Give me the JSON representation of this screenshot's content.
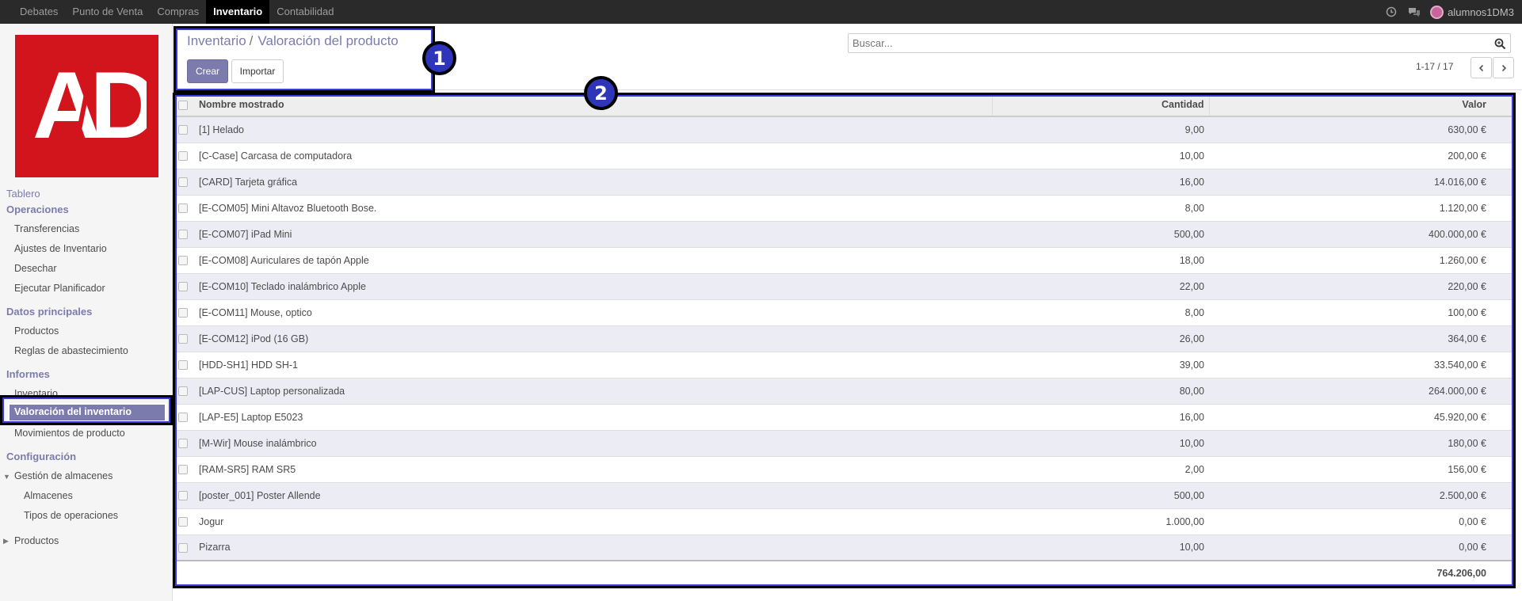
{
  "topbar": {
    "menu": [
      "Debates",
      "Punto de Venta",
      "Compras",
      "Inventario",
      "Contabilidad"
    ],
    "active_menu": "Inventario",
    "user": "alumnos1DM3",
    "icons": [
      "clock-icon",
      "chat-icon"
    ]
  },
  "logo": {
    "text": "AD",
    "color": "#d2141c"
  },
  "sidebar": {
    "tablero": "Tablero",
    "operaciones": "Operaciones",
    "operaciones_items": [
      "Transferencias",
      "Ajustes de Inventario",
      "Desechar",
      "Ejecutar Planificador"
    ],
    "datos": "Datos principales",
    "datos_items": [
      "Productos",
      "Reglas de abastecimiento"
    ],
    "informes": "Informes",
    "informes_items": [
      "Inventario",
      "Valoración del inventario",
      "Movimientos de producto"
    ],
    "active_item": "Valoración del inventario",
    "configuracion": "Configuración",
    "gestion": "Gestión de almacenes",
    "gestion_items": [
      "Almacenes",
      "Tipos de operaciones"
    ],
    "productos": "Productos"
  },
  "control": {
    "breadcrumb_parent": "Inventario",
    "breadcrumb_sep": "/",
    "breadcrumb_current": "Valoración del producto",
    "create_label": "Crear",
    "import_label": "Importar",
    "search_placeholder": "Buscar...",
    "pager": "1-17 / 17"
  },
  "annotations": {
    "badge1": "1",
    "badge2": "2"
  },
  "table": {
    "headers": {
      "name": "Nombre mostrado",
      "qty": "Cantidad",
      "value": "Valor"
    },
    "rows": [
      {
        "name": "[1] Helado",
        "qty": "9,00",
        "value": "630,00 €"
      },
      {
        "name": "[C-Case] Carcasa de computadora",
        "qty": "10,00",
        "value": "200,00 €"
      },
      {
        "name": "[CARD] Tarjeta gráfica",
        "qty": "16,00",
        "value": "14.016,00 €"
      },
      {
        "name": "[E-COM05] Mini Altavoz Bluetooth Bose.",
        "qty": "8,00",
        "value": "1.120,00 €"
      },
      {
        "name": "[E-COM07] iPad Mini",
        "qty": "500,00",
        "value": "400.000,00 €"
      },
      {
        "name": "[E-COM08] Auriculares de tapón Apple",
        "qty": "18,00",
        "value": "1.260,00 €"
      },
      {
        "name": "[E-COM10] Teclado inalámbrico Apple",
        "qty": "22,00",
        "value": "220,00 €"
      },
      {
        "name": "[E-COM11] Mouse, optico",
        "qty": "8,00",
        "value": "100,00 €"
      },
      {
        "name": "[E-COM12] iPod (16 GB)",
        "qty": "26,00",
        "value": "364,00 €"
      },
      {
        "name": "[HDD-SH1] HDD SH-1",
        "qty": "39,00",
        "value": "33.540,00 €"
      },
      {
        "name": "[LAP-CUS] Laptop personalizada",
        "qty": "80,00",
        "value": "264.000,00 €"
      },
      {
        "name": "[LAP-E5] Laptop E5023",
        "qty": "16,00",
        "value": "45.920,00 €"
      },
      {
        "name": "[M-Wir] Mouse inalámbrico",
        "qty": "10,00",
        "value": "180,00 €"
      },
      {
        "name": "[RAM-SR5] RAM SR5",
        "qty": "2,00",
        "value": "156,00 €"
      },
      {
        "name": "[poster_001] Poster Allende",
        "qty": "500,00",
        "value": "2.500,00 €"
      },
      {
        "name": "Jogur",
        "qty": "1.000,00",
        "value": "0,00 €"
      },
      {
        "name": "Pizarra",
        "qty": "10,00",
        "value": "0,00 €"
      }
    ],
    "total": "764.206,00"
  },
  "colors": {
    "brand": "#7c7bad",
    "topbar": "#2a2a2a",
    "annotation": "#2f35b9"
  }
}
